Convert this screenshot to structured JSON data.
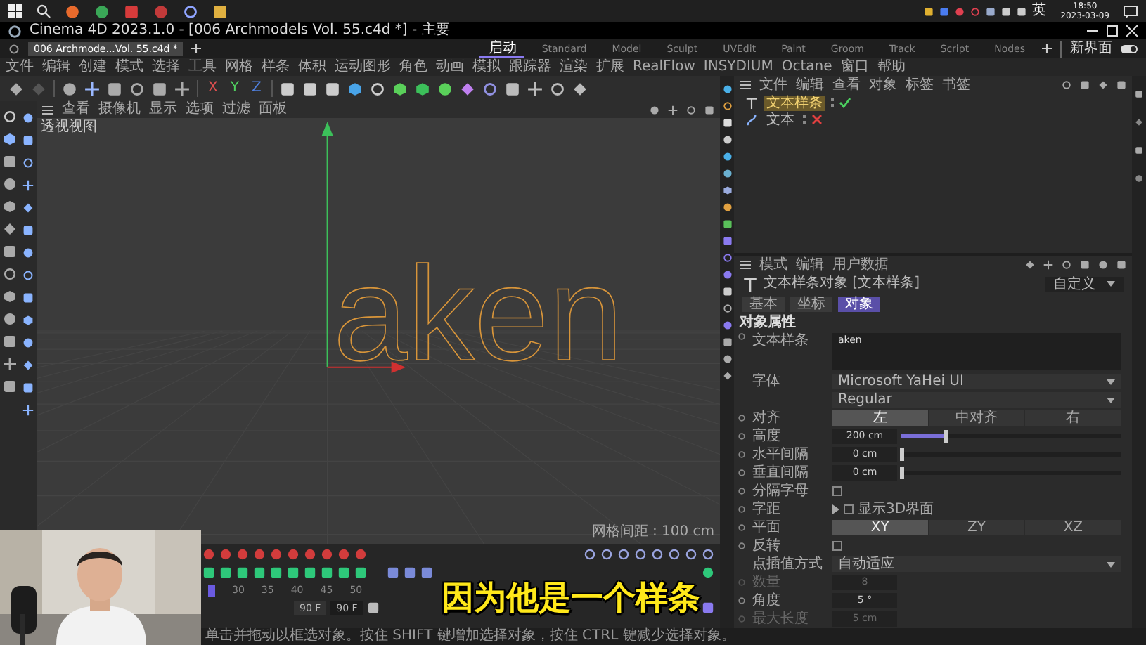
{
  "tray": {
    "language": "英",
    "time": "18:50",
    "date": "2023-03-09"
  },
  "title_bar": {
    "title": "Cinema 4D 2023.1.0 - [006 Archmodels Vol. 55.c4d *] - 主要"
  },
  "doc_tabs": [
    {
      "label": "006 Archmode...Vol. 55.c4d *",
      "selected": true
    }
  ],
  "layouts": [
    {
      "label": "启动",
      "selected": true
    },
    {
      "label": "Standard",
      "selected": false
    },
    {
      "label": "Model",
      "selected": false
    },
    {
      "label": "Sculpt",
      "selected": false
    },
    {
      "label": "UVEdit",
      "selected": false
    },
    {
      "label": "Paint",
      "selected": false
    },
    {
      "label": "Groom",
      "selected": false
    },
    {
      "label": "Track",
      "selected": false
    },
    {
      "label": "Script",
      "selected": false
    },
    {
      "label": "Nodes",
      "selected": false
    }
  ],
  "new_layout": "新界面",
  "layout_toggle": {
    "on": true
  },
  "menu": [
    "文件",
    "编辑",
    "创建",
    "模式",
    "选择",
    "工具",
    "网格",
    "样条",
    "体积",
    "运动图形",
    "角色",
    "动画",
    "模拟",
    "跟踪器",
    "渲染",
    "扩展",
    "RealFlow",
    "INSYDIUM",
    "Octane",
    "窗口",
    "帮助"
  ],
  "toolbar": {
    "axis_buttons": [
      "X",
      "Y",
      "Z"
    ]
  },
  "viewport": {
    "menu": [
      "查看",
      "摄像机",
      "显示",
      "选项",
      "过滤",
      "面板"
    ],
    "label": "透视视图",
    "object_text": "aken",
    "grid_info": "网格间距 : 100 cm"
  },
  "timeline": {
    "ticks": [
      "30",
      "35",
      "40",
      "45",
      "50"
    ],
    "frame_start": "90 F",
    "frame_end": "90 F"
  },
  "objects": {
    "menu": [
      "文件",
      "编辑",
      "查看",
      "对象",
      "标签",
      "书签"
    ],
    "items": [
      {
        "name": "文本样条",
        "kind": "text_spline",
        "selected": true,
        "enabled": true
      },
      {
        "name": "文本",
        "kind": "text",
        "selected": false,
        "enabled": false
      }
    ]
  },
  "attributes": {
    "menu": [
      "模式",
      "编辑",
      "用户数据"
    ],
    "title": "文本样条对象 [文本样条]",
    "preset": "自定义",
    "tabs": [
      {
        "label": "基本",
        "selected": false
      },
      {
        "label": "坐标",
        "selected": false
      },
      {
        "label": "对象",
        "selected": true
      }
    ],
    "section": "对象属性",
    "fields": [
      {
        "kind": "textarea",
        "label": "文本样条",
        "value": "aken"
      },
      {
        "kind": "dropdown",
        "label": "字体",
        "value": "Microsoft YaHei UI"
      },
      {
        "kind": "dropdown",
        "value": "Regular"
      },
      {
        "kind": "segmented",
        "label": "对齐",
        "options": [
          {
            "label": "左",
            "selected": true
          },
          {
            "label": "中对齐",
            "selected": false
          },
          {
            "label": "右",
            "selected": false
          }
        ]
      },
      {
        "kind": "slider",
        "label": "高度",
        "value": "200 cm",
        "level": 0.2
      },
      {
        "kind": "slider",
        "label": "水平间隔",
        "value": "0 cm",
        "level": 0
      },
      {
        "kind": "slider",
        "label": "垂直间隔",
        "value": "0 cm",
        "level": 0
      },
      {
        "kind": "checkbox",
        "label": "分隔字母",
        "checked": false
      },
      {
        "kind": "expander",
        "label": "字距",
        "text": "显示3D界面",
        "checked": false,
        "expanded": false
      },
      {
        "kind": "segmented",
        "label": "平面",
        "options": [
          {
            "label": "XY",
            "selected": true
          },
          {
            "label": "ZY",
            "selected": false
          },
          {
            "label": "XZ",
            "selected": false
          }
        ]
      },
      {
        "kind": "checkbox",
        "label": "反转",
        "checked": false
      },
      {
        "kind": "dropdown",
        "label": "点插值方式",
        "value": "自动适应"
      },
      {
        "kind": "number",
        "label": "数量",
        "value": "8",
        "disabled": true
      },
      {
        "kind": "number",
        "label": "角度",
        "value": "5 °",
        "disabled": false
      },
      {
        "kind": "number",
        "label": "最大长度",
        "value": "5 cm",
        "disabled": true
      }
    ]
  },
  "status_bar": "单击并拖动以框选对象。按住 SHIFT 键增加选择对象，按住 CTRL 键减少选择对象。",
  "subtitle": "因为他是一个样条"
}
